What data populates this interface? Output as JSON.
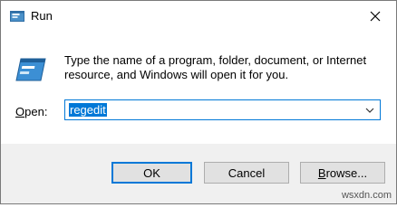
{
  "window": {
    "title": "Run",
    "close_glyph": "✕"
  },
  "message": {
    "line1": "Type the name of a program, folder, document, or Internet",
    "line2": "resource, and Windows will open it for you."
  },
  "open_field": {
    "label_accesskey": "O",
    "label_rest": "pen:",
    "value": "regedit"
  },
  "buttons": {
    "ok": "OK",
    "cancel": "Cancel",
    "browse_accesskey": "B",
    "browse_rest": "rowse..."
  },
  "watermark": "wsxdn.com",
  "colors": {
    "accent": "#0078d7",
    "footer": "#f0f0f0",
    "button": "#e1e1e1"
  },
  "icons": {
    "app": "run-icon",
    "close": "close-icon",
    "dropdown": "chevron-down-icon"
  }
}
